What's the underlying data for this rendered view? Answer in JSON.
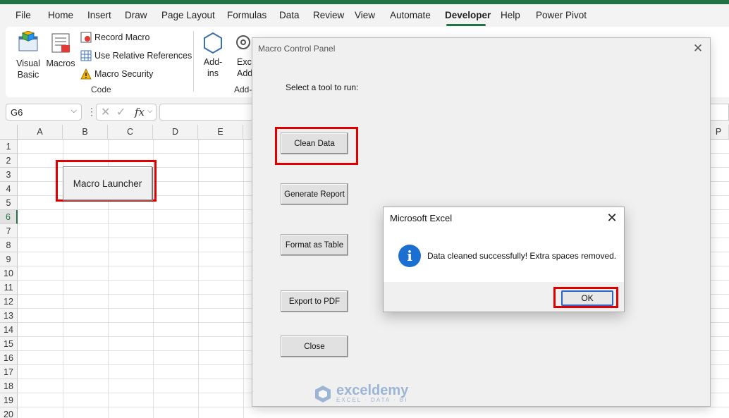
{
  "menu": {
    "tabs": [
      "File",
      "Home",
      "Insert",
      "Draw",
      "Page Layout",
      "Formulas",
      "Data",
      "Review",
      "View",
      "Automate",
      "Developer",
      "Help",
      "Power Pivot"
    ],
    "active": "Developer"
  },
  "ribbon": {
    "visual_basic": "Visual Basic",
    "visual_basic_l1": "Visual",
    "visual_basic_l2": "Basic",
    "macros": "Macros",
    "record_macro": "Record Macro",
    "relative_refs": "Use Relative References",
    "macro_security": "Macro Security",
    "code_group": "Code",
    "addins_l1": "Add-",
    "addins_l2": "ins",
    "excel_addins_l1": "Exce",
    "excel_addins_l2": "Add-i",
    "addins_group": "Add-"
  },
  "formula_bar": {
    "cell_ref": "G6",
    "fx": "fx"
  },
  "sheet": {
    "columns": [
      "A",
      "B",
      "C",
      "D",
      "E",
      "P"
    ],
    "rows": [
      "1",
      "2",
      "3",
      "4",
      "5",
      "6",
      "7",
      "8",
      "9",
      "10",
      "11",
      "12",
      "13",
      "14",
      "15",
      "16",
      "17",
      "18",
      "19",
      "20"
    ],
    "selected_row": "6",
    "launcher_label": "Macro Launcher"
  },
  "panel": {
    "title": "Macro Control Panel",
    "prompt": "Select a tool to run:",
    "buttons": {
      "clean": "Clean Data",
      "report": "Generate Report",
      "format": "Format as Table",
      "export": "Export to PDF",
      "close": "Close"
    }
  },
  "msgbox": {
    "title": "Microsoft Excel",
    "icon_glyph": "i",
    "message": "Data cleaned successfully! Extra spaces removed.",
    "ok": "OK"
  },
  "watermark": {
    "name": "exceldemy",
    "sub": "EXCEL · DATA · BI"
  },
  "colors": {
    "excel_green": "#217346",
    "highlight_red": "#e00000",
    "info_blue": "#1a6fd0"
  }
}
